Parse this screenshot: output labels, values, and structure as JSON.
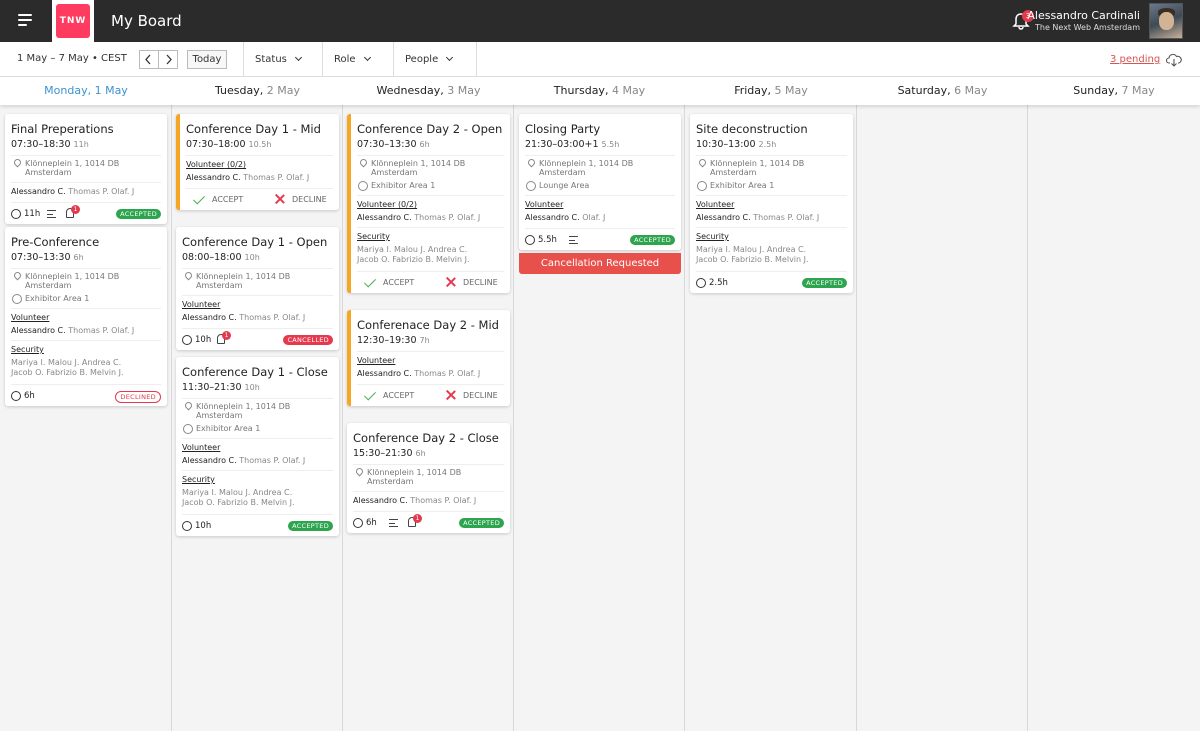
{
  "header": {
    "title": "My Board",
    "logo": "TNW",
    "notif_count": "3",
    "user_name": "Alessandro Cardinali",
    "user_org": "The Next Web Amsterdam"
  },
  "toolbar": {
    "range": "1 May – 7 May • CEST",
    "today": "Today",
    "status": "Status",
    "role": "Role",
    "people": "People",
    "pending": "3 pending"
  },
  "days": [
    {
      "name": "Monday,",
      "num": "1 May"
    },
    {
      "name": "Tuesday,",
      "num": "2 May"
    },
    {
      "name": "Wednesday,",
      "num": "3 May"
    },
    {
      "name": "Thursday,",
      "num": "4 May"
    },
    {
      "name": "Friday,",
      "num": "5 May"
    },
    {
      "name": "Saturday,",
      "num": "6 May"
    },
    {
      "name": "Sunday,",
      "num": "7 May"
    }
  ],
  "common": {
    "location": "Klönneplein 1, 1014 DB Amsterdam",
    "exhibitor": "Exhibitor Area 1",
    "lounge": "Lounge Area",
    "volunteer": "Volunteer",
    "volunteer_count": "(0/2)",
    "security": "Security",
    "ppl_a": "Alessandro C.",
    "ppl_b": "Thomas P. Olaf. J",
    "ppl_c": "Olaf. J",
    "sec1": "Mariya I. Malou J. Andrea C.",
    "sec2": "Jacob O. Fabrizio B. Melvin J.",
    "accept": "ACCEPT",
    "decline": "DECLINE",
    "accepted": "ACCEPTED",
    "cancelled": "CANCELLED",
    "declined": "DECLINED",
    "cancel_req": "Cancellation Requested"
  },
  "cards": {
    "final_prep": {
      "title": "Final Preperations",
      "time": "07:30–18:30",
      "dur": "11h",
      "hours": "11h",
      "badge": "1"
    },
    "pre_conf": {
      "title": "Pre-Conference",
      "time": "07:30–13:30",
      "dur": "6h",
      "hours": "6h"
    },
    "day1_mid": {
      "title": "Conference Day 1 - Mid",
      "time": "07:30–18:00",
      "dur": "10.5h"
    },
    "day1_open": {
      "title": "Conference Day 1 - Open",
      "time": "08:00–18:00",
      "dur": "10h",
      "hours": "10h",
      "badge": "1"
    },
    "day1_close": {
      "title": "Conference Day 1 - Close",
      "time": "11:30–21:30",
      "dur": "10h",
      "hours": "10h"
    },
    "day2_open": {
      "title": "Conference Day 2 - Open",
      "time": "07:30–13:30",
      "dur": "6h"
    },
    "day2_mid": {
      "title": "Conferenace Day 2 - Mid",
      "time": "12:30–19:30",
      "dur": "7h"
    },
    "day2_close": {
      "title": "Conference Day 2 - Close",
      "time": "15:30–21:30",
      "dur": "6h",
      "hours": "6h",
      "badge": "1"
    },
    "closing": {
      "title": "Closing Party",
      "time": "21:30–03:00+1",
      "dur": "5.5h",
      "hours": "5.5h"
    },
    "site_decon": {
      "title": "Site deconstruction",
      "time": "10:30–13:00",
      "dur": "2.5h",
      "hours": "2.5h"
    }
  }
}
